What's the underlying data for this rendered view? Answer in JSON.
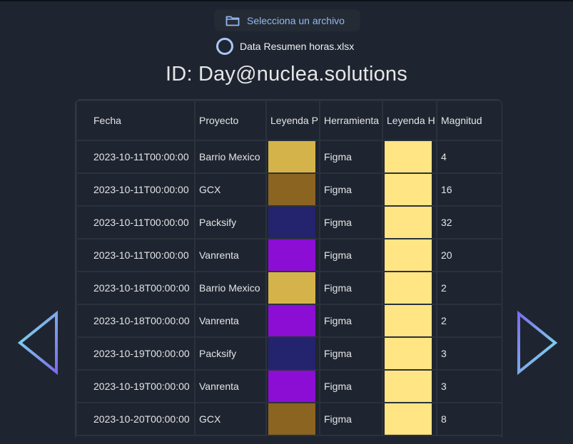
{
  "file_picker": {
    "button_label": "Selecciona un archivo",
    "selected_file": "Data Resumen horas.xlsx"
  },
  "page_title": "ID: Day@nuclea.solutions",
  "table": {
    "headers": [
      "Fecha",
      "Proyecto",
      "Leyenda P",
      "Herramienta",
      "Leyenda H",
      "Magnitud"
    ],
    "rows": [
      {
        "fecha": "2023-10-11T00:00:00",
        "proyecto": "Barrio Mexico",
        "leyenda_p": "#d4b44a",
        "herramienta": "Figma",
        "leyenda_h": "#ffe583",
        "magnitud": "4"
      },
      {
        "fecha": "2023-10-11T00:00:00",
        "proyecto": "GCX",
        "leyenda_p": "#8b6422",
        "herramienta": "Figma",
        "leyenda_h": "#ffe583",
        "magnitud": "16"
      },
      {
        "fecha": "2023-10-11T00:00:00",
        "proyecto": "Packsify",
        "leyenda_p": "#23236e",
        "herramienta": "Figma",
        "leyenda_h": "#ffe583",
        "magnitud": "32"
      },
      {
        "fecha": "2023-10-11T00:00:00",
        "proyecto": "Vanrenta",
        "leyenda_p": "#8c0ed4",
        "herramienta": "Figma",
        "leyenda_h": "#ffe583",
        "magnitud": "20"
      },
      {
        "fecha": "2023-10-18T00:00:00",
        "proyecto": "Barrio Mexico",
        "leyenda_p": "#d4b44a",
        "herramienta": "Figma",
        "leyenda_h": "#ffe583",
        "magnitud": "2"
      },
      {
        "fecha": "2023-10-18T00:00:00",
        "proyecto": "Vanrenta",
        "leyenda_p": "#8c0ed4",
        "herramienta": "Figma",
        "leyenda_h": "#ffe583",
        "magnitud": "2"
      },
      {
        "fecha": "2023-10-19T00:00:00",
        "proyecto": "Packsify",
        "leyenda_p": "#23236e",
        "herramienta": "Figma",
        "leyenda_h": "#ffe583",
        "magnitud": "3"
      },
      {
        "fecha": "2023-10-19T00:00:00",
        "proyecto": "Vanrenta",
        "leyenda_p": "#8c0ed4",
        "herramienta": "Figma",
        "leyenda_h": "#ffe583",
        "magnitud": "3"
      },
      {
        "fecha": "2023-10-20T00:00:00",
        "proyecto": "GCX",
        "leyenda_p": "#8b6422",
        "herramienta": "Figma",
        "leyenda_h": "#ffe583",
        "magnitud": "8"
      }
    ]
  },
  "navigation": {
    "prev_icon": "triangle-left-icon",
    "next_icon": "triangle-right-icon",
    "gradient": [
      "#7b6cf0",
      "#7ee8e8"
    ]
  }
}
